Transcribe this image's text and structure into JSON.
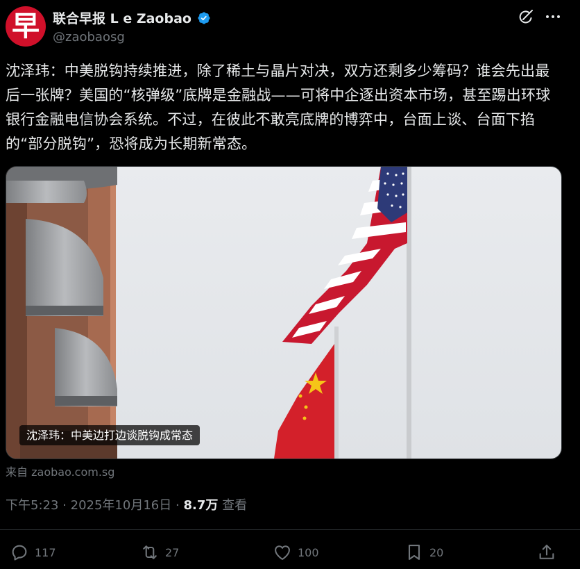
{
  "author": {
    "display_name": "联合早报 Lianhe Zaobao",
    "display_name_visible": "联合早报 L  e Zaobao",
    "handle": "@zaobaosg",
    "avatar_glyph": "早",
    "avatar_color": "#d0102a",
    "verified_icon": "verified-badge-icon",
    "verified_color": "#1d9bf0"
  },
  "header_icons": {
    "grok": "grok-icon",
    "more": "more-icon"
  },
  "tweet": {
    "text": "沈泽玮：中美脱钩持续推进，除了稀土与晶片对决，双方还剩多少筹码？谁会先出最后一张牌？美国的“核弹级”底牌是金融战——可将中企逐出资本市场，甚至踢出环球银行金融电信协会系统。不过，在彼此不敢亮底牌的博弈中，台面上谈、台面下掐的“部分脱钩”，恐将成为长期新常态。",
    "media_caption": "沈泽玮：中美边打边谈脱钩成常态",
    "source_prefix": "来自",
    "source_domain": "zaobao.com.sg",
    "time": "下午5:23",
    "date": "2025年10月16日",
    "separator": "·",
    "views_count": "8.7万",
    "views_label": "查看"
  },
  "actions": {
    "reply": {
      "icon": "reply-icon",
      "count": "117"
    },
    "retweet": {
      "icon": "retweet-icon",
      "count": "27"
    },
    "like": {
      "icon": "heart-icon",
      "count": "100"
    },
    "bookmark": {
      "icon": "bookmark-icon",
      "count": "20"
    },
    "share": {
      "icon": "share-icon"
    }
  },
  "colors": {
    "background": "#000000",
    "text_primary": "#e7e9ea",
    "text_secondary": "#71767b",
    "accent": "#1d9bf0",
    "divider": "#2f3336"
  }
}
